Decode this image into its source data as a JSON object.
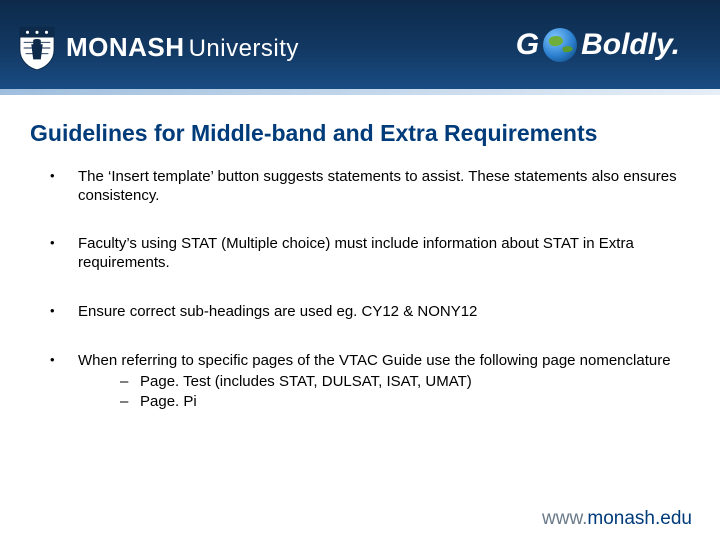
{
  "header": {
    "brand_strong": "MONASH",
    "brand_light": "University",
    "tagline_prefix": "G",
    "tagline_suffix": " Boldly."
  },
  "title": "Guidelines for Middle-band and Extra Requirements",
  "bullets": [
    {
      "text": "The ‘Insert template’ button suggests statements to assist.   These statements also ensures consistency."
    },
    {
      "text": "Faculty’s using STAT (Multiple choice) must include information about STAT in Extra requirements."
    },
    {
      "text": "Ensure correct sub-headings are used eg. CY12 & NONY12"
    },
    {
      "text": "When referring to specific pages of the VTAC Guide use the following page nomenclature",
      "sub": [
        "Page. Test (includes STAT, DULSAT, ISAT, UMAT)",
        "Page. Pi"
      ]
    }
  ],
  "footer": {
    "www": "www.",
    "domain": "monash",
    "tld": ".edu"
  }
}
